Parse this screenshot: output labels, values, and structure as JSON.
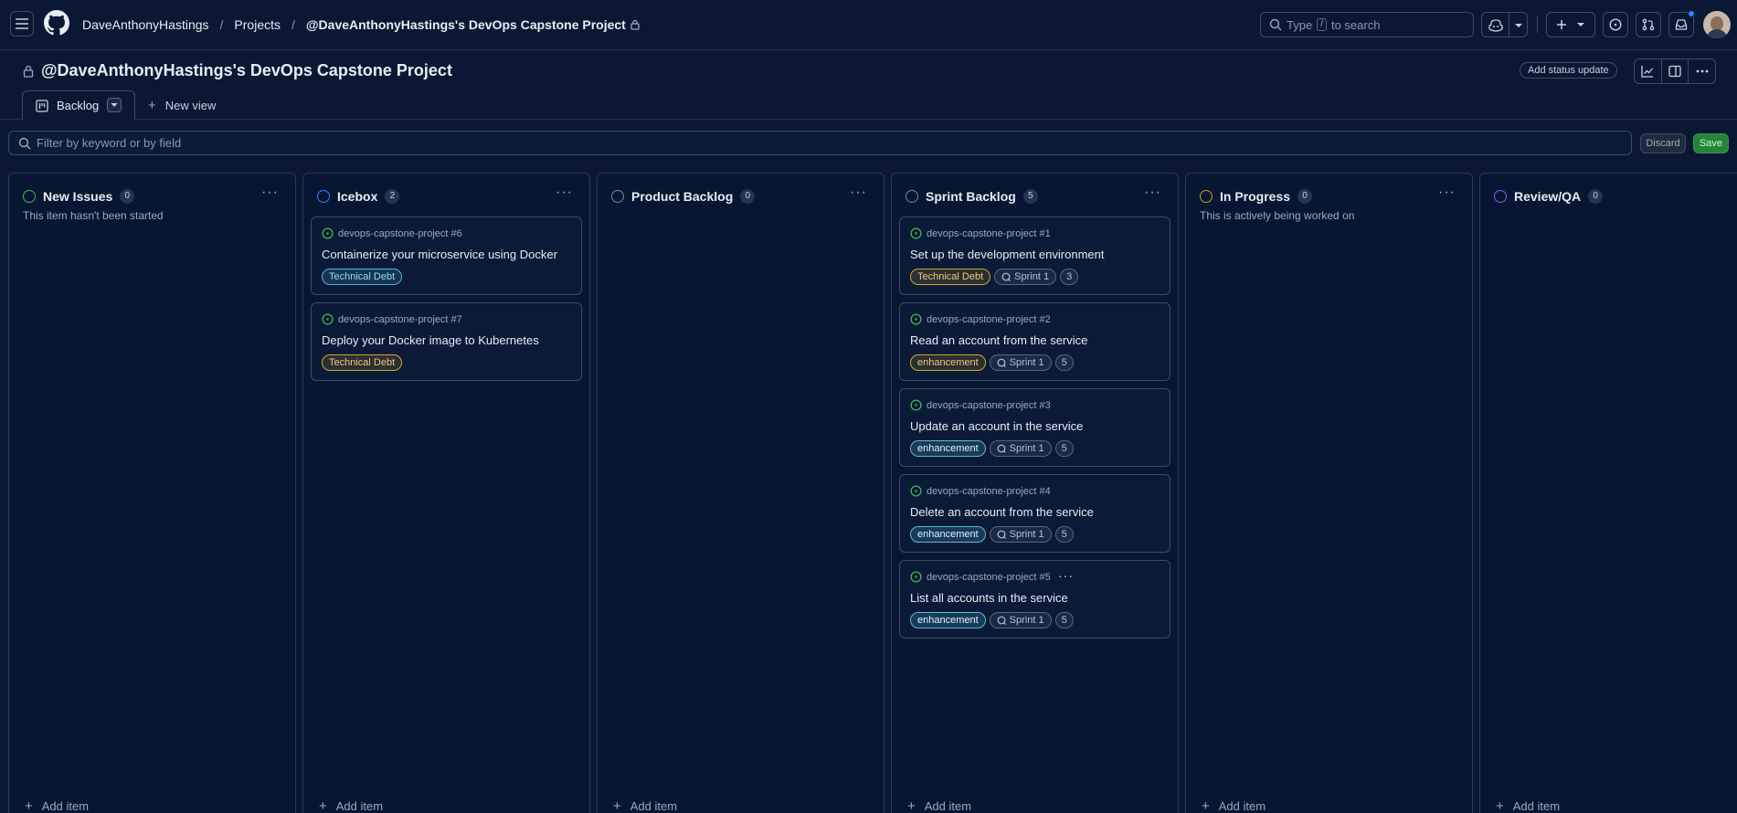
{
  "nav": {
    "owner": "DaveAnthonyHastings",
    "projects": "Projects",
    "project": "@DaveAnthonyHastings's DevOps Capstone Project",
    "search_prefix": "Type",
    "search_key": "/",
    "search_suffix": "to search"
  },
  "header": {
    "title": "@DaveAnthonyHastings's DevOps Capstone Project",
    "status_update": "Add status update"
  },
  "tabs": {
    "active": "Backlog",
    "new_view": "New view"
  },
  "filter": {
    "placeholder": "Filter by keyword or by field",
    "discard": "Discard",
    "save": "Save"
  },
  "colors": {
    "status_green": "#3fb950",
    "status_blue": "#2f81f7",
    "status_gray": "#7d8590",
    "status_yellow": "#d29922",
    "status_purple": "#8957e5",
    "open_issue": "#3fb950"
  },
  "columns": [
    {
      "name": "New Issues",
      "count": "0",
      "description": "This item hasn't been started",
      "add": "Add item"
    },
    {
      "name": "Icebox",
      "count": "2",
      "description": "",
      "add": "Add item"
    },
    {
      "name": "Product Backlog",
      "count": "0",
      "description": "",
      "add": "Add item"
    },
    {
      "name": "Sprint Backlog",
      "count": "5",
      "description": "",
      "add": "Add item"
    },
    {
      "name": "In Progress",
      "count": "0",
      "description": "This is actively being worked on",
      "add": "Add item"
    },
    {
      "name": "Review/QA",
      "count": "0",
      "description": "",
      "add": "Add item"
    }
  ],
  "icebox_cards": [
    {
      "repo": "devops-capstone-project #6",
      "title": "Containerize your microservice using Docker",
      "label": "Technical Debt"
    },
    {
      "repo": "devops-capstone-project #7",
      "title": "Deploy your Docker image to Kubernetes",
      "label": "Technical Debt"
    }
  ],
  "sprint_cards": [
    {
      "repo": "devops-capstone-project #1",
      "title": "Set up the development environment",
      "label": "Technical Debt",
      "sprint": "Sprint 1",
      "points": "3"
    },
    {
      "repo": "devops-capstone-project #2",
      "title": "Read an account from the service",
      "label": "enhancement",
      "sprint": "Sprint 1",
      "points": "5"
    },
    {
      "repo": "devops-capstone-project #3",
      "title": "Update an account in the service",
      "label": "enhancement",
      "sprint": "Sprint 1",
      "points": "5"
    },
    {
      "repo": "devops-capstone-project #4",
      "title": "Delete an account from the service",
      "label": "enhancement",
      "sprint": "Sprint 1",
      "points": "5"
    },
    {
      "repo": "devops-capstone-project #5",
      "title": "List all accounts in the service",
      "label": "enhancement",
      "sprint": "Sprint 1",
      "points": "5"
    }
  ]
}
